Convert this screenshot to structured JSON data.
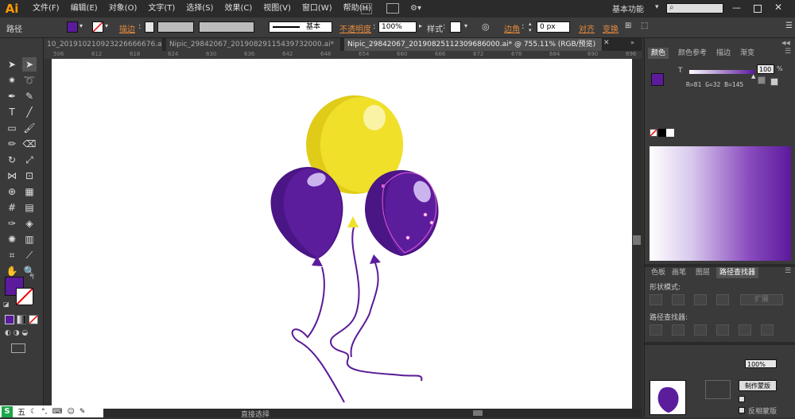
{
  "app": {
    "logo": "Ai"
  },
  "menu": [
    "文件(F)",
    "编辑(E)",
    "对象(O)",
    "文字(T)",
    "选择(S)",
    "效果(C)",
    "视图(V)",
    "窗口(W)",
    "帮助(H)"
  ],
  "workspace": {
    "label": "基本功能",
    "search_placeholder": ""
  },
  "control": {
    "object_type": "路径",
    "stroke_label": "描边",
    "brush_label": "基本",
    "opacity_label": "不透明度",
    "opacity_value": "100%",
    "style_label": "样式",
    "corner_label": "边角",
    "corner_value": "0 px",
    "align_label": "对齐",
    "transform_label": "变换"
  },
  "tabs": [
    "10_201910210923226666676.ai*",
    "Nipic_29842067_20190829115439732000.ai*",
    "Nipic_29842067_20190825112309686000.ai* @ 755.11% (RGB/预览)"
  ],
  "ruler_ticks": [
    "506",
    "612",
    "618",
    "624",
    "630",
    "636",
    "642",
    "648",
    "654",
    "660",
    "666",
    "672",
    "678",
    "684",
    "690",
    "696"
  ],
  "colors": {
    "fill": "#5c1a9c",
    "balloon_yellow": "#f0e02a",
    "balloon_yellow_dark": "#e0cc18",
    "balloon_purple": "#5c1d9d",
    "balloon_purple_dark": "#4a1585",
    "string": "#5a1a98",
    "selection": "#e05cd6"
  },
  "color_panel": {
    "tabs": [
      "颜色",
      "颜色参考",
      "描边",
      "渐变"
    ],
    "t_label": "T",
    "tint_value": "100",
    "percent": "%",
    "rgb_readout": "R=81 G=32 B=145"
  },
  "lower_panel": {
    "tabs": [
      "色板",
      "画笔",
      "图层",
      "路径查找器"
    ],
    "shape_modes": "形状模式:",
    "expand": "扩展",
    "pathfinders": "路径查找器:"
  },
  "layers_panel": {
    "make_mask": "制作蒙版",
    "invert_mask": "反相蒙版",
    "opacity": "100%"
  },
  "status": {
    "tool": "直接选择"
  },
  "taskbar": {
    "items": [
      "S",
      "五"
    ]
  }
}
